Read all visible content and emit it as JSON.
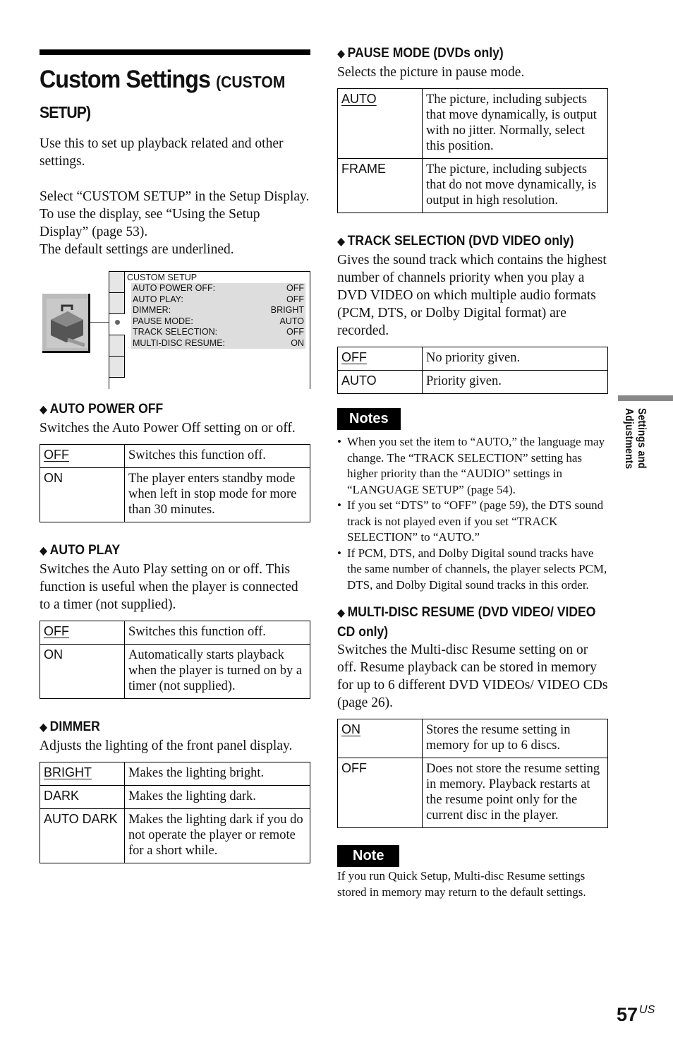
{
  "title": {
    "main": "Custom Settings",
    "sub1": "(CUSTOM",
    "sub2": "SETUP)"
  },
  "intro": [
    "Use this to set up playback related and other settings.",
    "Select “CUSTOM SETUP” in the Setup Display. To use the display, see “Using the Setup Display” (page 53).",
    "The default settings are underlined."
  ],
  "screen": {
    "header": "CUSTOM SETUP",
    "icon": "toolbox-icon",
    "items": [
      {
        "label": "AUTO POWER OFF:",
        "value": "OFF"
      },
      {
        "label": "AUTO PLAY:",
        "value": "OFF"
      },
      {
        "label": "DIMMER:",
        "value": "BRIGHT"
      },
      {
        "label": "PAUSE MODE:",
        "value": "AUTO"
      },
      {
        "label": "TRACK SELECTION:",
        "value": "OFF"
      },
      {
        "label": "MULTI-DISC RESUME:",
        "value": "ON"
      }
    ]
  },
  "sections": {
    "auto_power_off": {
      "heading": "AUTO POWER OFF",
      "desc": "Switches the Auto Power Off setting on or off.",
      "rows": [
        {
          "key": "OFF",
          "default": true,
          "text": "Switches this function off."
        },
        {
          "key": "ON",
          "default": false,
          "text": "The player enters standby mode when left in stop mode for more than 30 minutes."
        }
      ]
    },
    "auto_play": {
      "heading": "AUTO PLAY",
      "desc": "Switches the Auto Play setting on or off. This function is useful when the player is connected to a timer (not supplied).",
      "rows": [
        {
          "key": "OFF",
          "default": true,
          "text": "Switches this function off."
        },
        {
          "key": "ON",
          "default": false,
          "text": "Automatically starts playback when the player is turned on by a timer (not supplied)."
        }
      ]
    },
    "dimmer": {
      "heading": "DIMMER",
      "desc": "Adjusts the lighting of the front panel display.",
      "rows": [
        {
          "key": "BRIGHT",
          "default": true,
          "text": "Makes the lighting bright."
        },
        {
          "key": "DARK",
          "default": false,
          "text": "Makes the lighting dark."
        },
        {
          "key": "AUTO DARK",
          "default": false,
          "text": "Makes the lighting dark if you do not operate the player or remote for a short while."
        }
      ]
    },
    "pause_mode": {
      "heading": "PAUSE MODE (DVDs only)",
      "desc": "Selects the picture in pause mode.",
      "rows": [
        {
          "key": "AUTO",
          "default": true,
          "text": "The picture, including subjects that move dynamically, is output with no jitter. Normally, select this position."
        },
        {
          "key": "FRAME",
          "default": false,
          "text": "The picture, including subjects that do not move dynamically, is output in high resolution."
        }
      ]
    },
    "track_selection": {
      "heading": "TRACK SELECTION (DVD VIDEO only)",
      "desc": "Gives the sound track which contains the highest number of channels priority when you play a DVD VIDEO on which multiple audio formats (PCM, DTS, or Dolby Digital format) are recorded.",
      "rows": [
        {
          "key": "OFF",
          "default": true,
          "text": "No priority given."
        },
        {
          "key": "AUTO",
          "default": false,
          "text": "Priority given."
        }
      ]
    },
    "multi_disc": {
      "heading": "MULTI-DISC RESUME (DVD VIDEO/ VIDEO CD only)",
      "desc": "Switches the Multi-disc Resume setting on or off. Resume playback can be stored in memory for up to 6 different DVD VIDEOs/ VIDEO CDs (page 26).",
      "rows": [
        {
          "key": "ON",
          "default": true,
          "text": "Stores the resume setting in memory for up to 6 discs."
        },
        {
          "key": "OFF",
          "default": false,
          "text": "Does not store the resume setting in memory. Playback restarts at the resume point only for the current disc in the player."
        }
      ]
    }
  },
  "notes": {
    "label": "Notes",
    "items": [
      "When you set the item to “AUTO,” the language may change. The “TRACK SELECTION” setting has higher priority than the “AUDIO” settings in “LANGUAGE SETUP” (page 54).",
      "If you set “DTS” to “OFF” (page 59), the DTS sound track is not played even if you set “TRACK SELECTION” to “AUTO.”",
      "If PCM, DTS, and Dolby Digital sound tracks have the same number of channels, the player selects PCM, DTS, and Dolby Digital sound tracks in this order."
    ]
  },
  "note": {
    "label": "Note",
    "text": "If you run Quick Setup, Multi-disc Resume settings stored in memory may return to the default settings."
  },
  "side_tab": "Settings and Adjustments",
  "page": {
    "number": "57",
    "suffix": "US"
  }
}
